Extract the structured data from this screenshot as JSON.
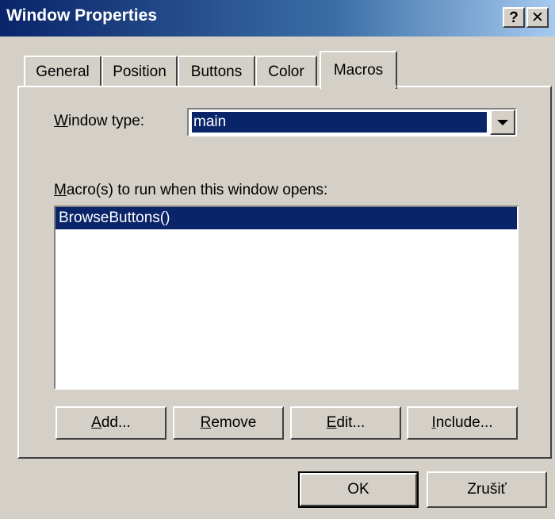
{
  "window": {
    "title": "Window Properties",
    "help_label": "?",
    "close_label": "✕"
  },
  "tabs": [
    {
      "label": "General",
      "active": false
    },
    {
      "label": "Position",
      "active": false
    },
    {
      "label": "Buttons",
      "active": false
    },
    {
      "label": "Color",
      "active": false
    },
    {
      "label": "Macros",
      "active": true
    }
  ],
  "macros": {
    "window_type_label_accel": "W",
    "window_type_label_rest": "indow type:",
    "window_type_value": "main",
    "macros_label_accel": "M",
    "macros_label_rest": "acro(s) to run when this window opens:",
    "macro_items": [
      "BrowseButtons()"
    ],
    "add_accel": "A",
    "add_rest": "dd...",
    "remove_accel": "R",
    "remove_rest": "emove",
    "edit_accel": "E",
    "edit_rest": "dit...",
    "include_accel": "I",
    "include_rest": "nclude..."
  },
  "footer": {
    "ok_label": "OK",
    "cancel_label": "Zrušiť"
  }
}
